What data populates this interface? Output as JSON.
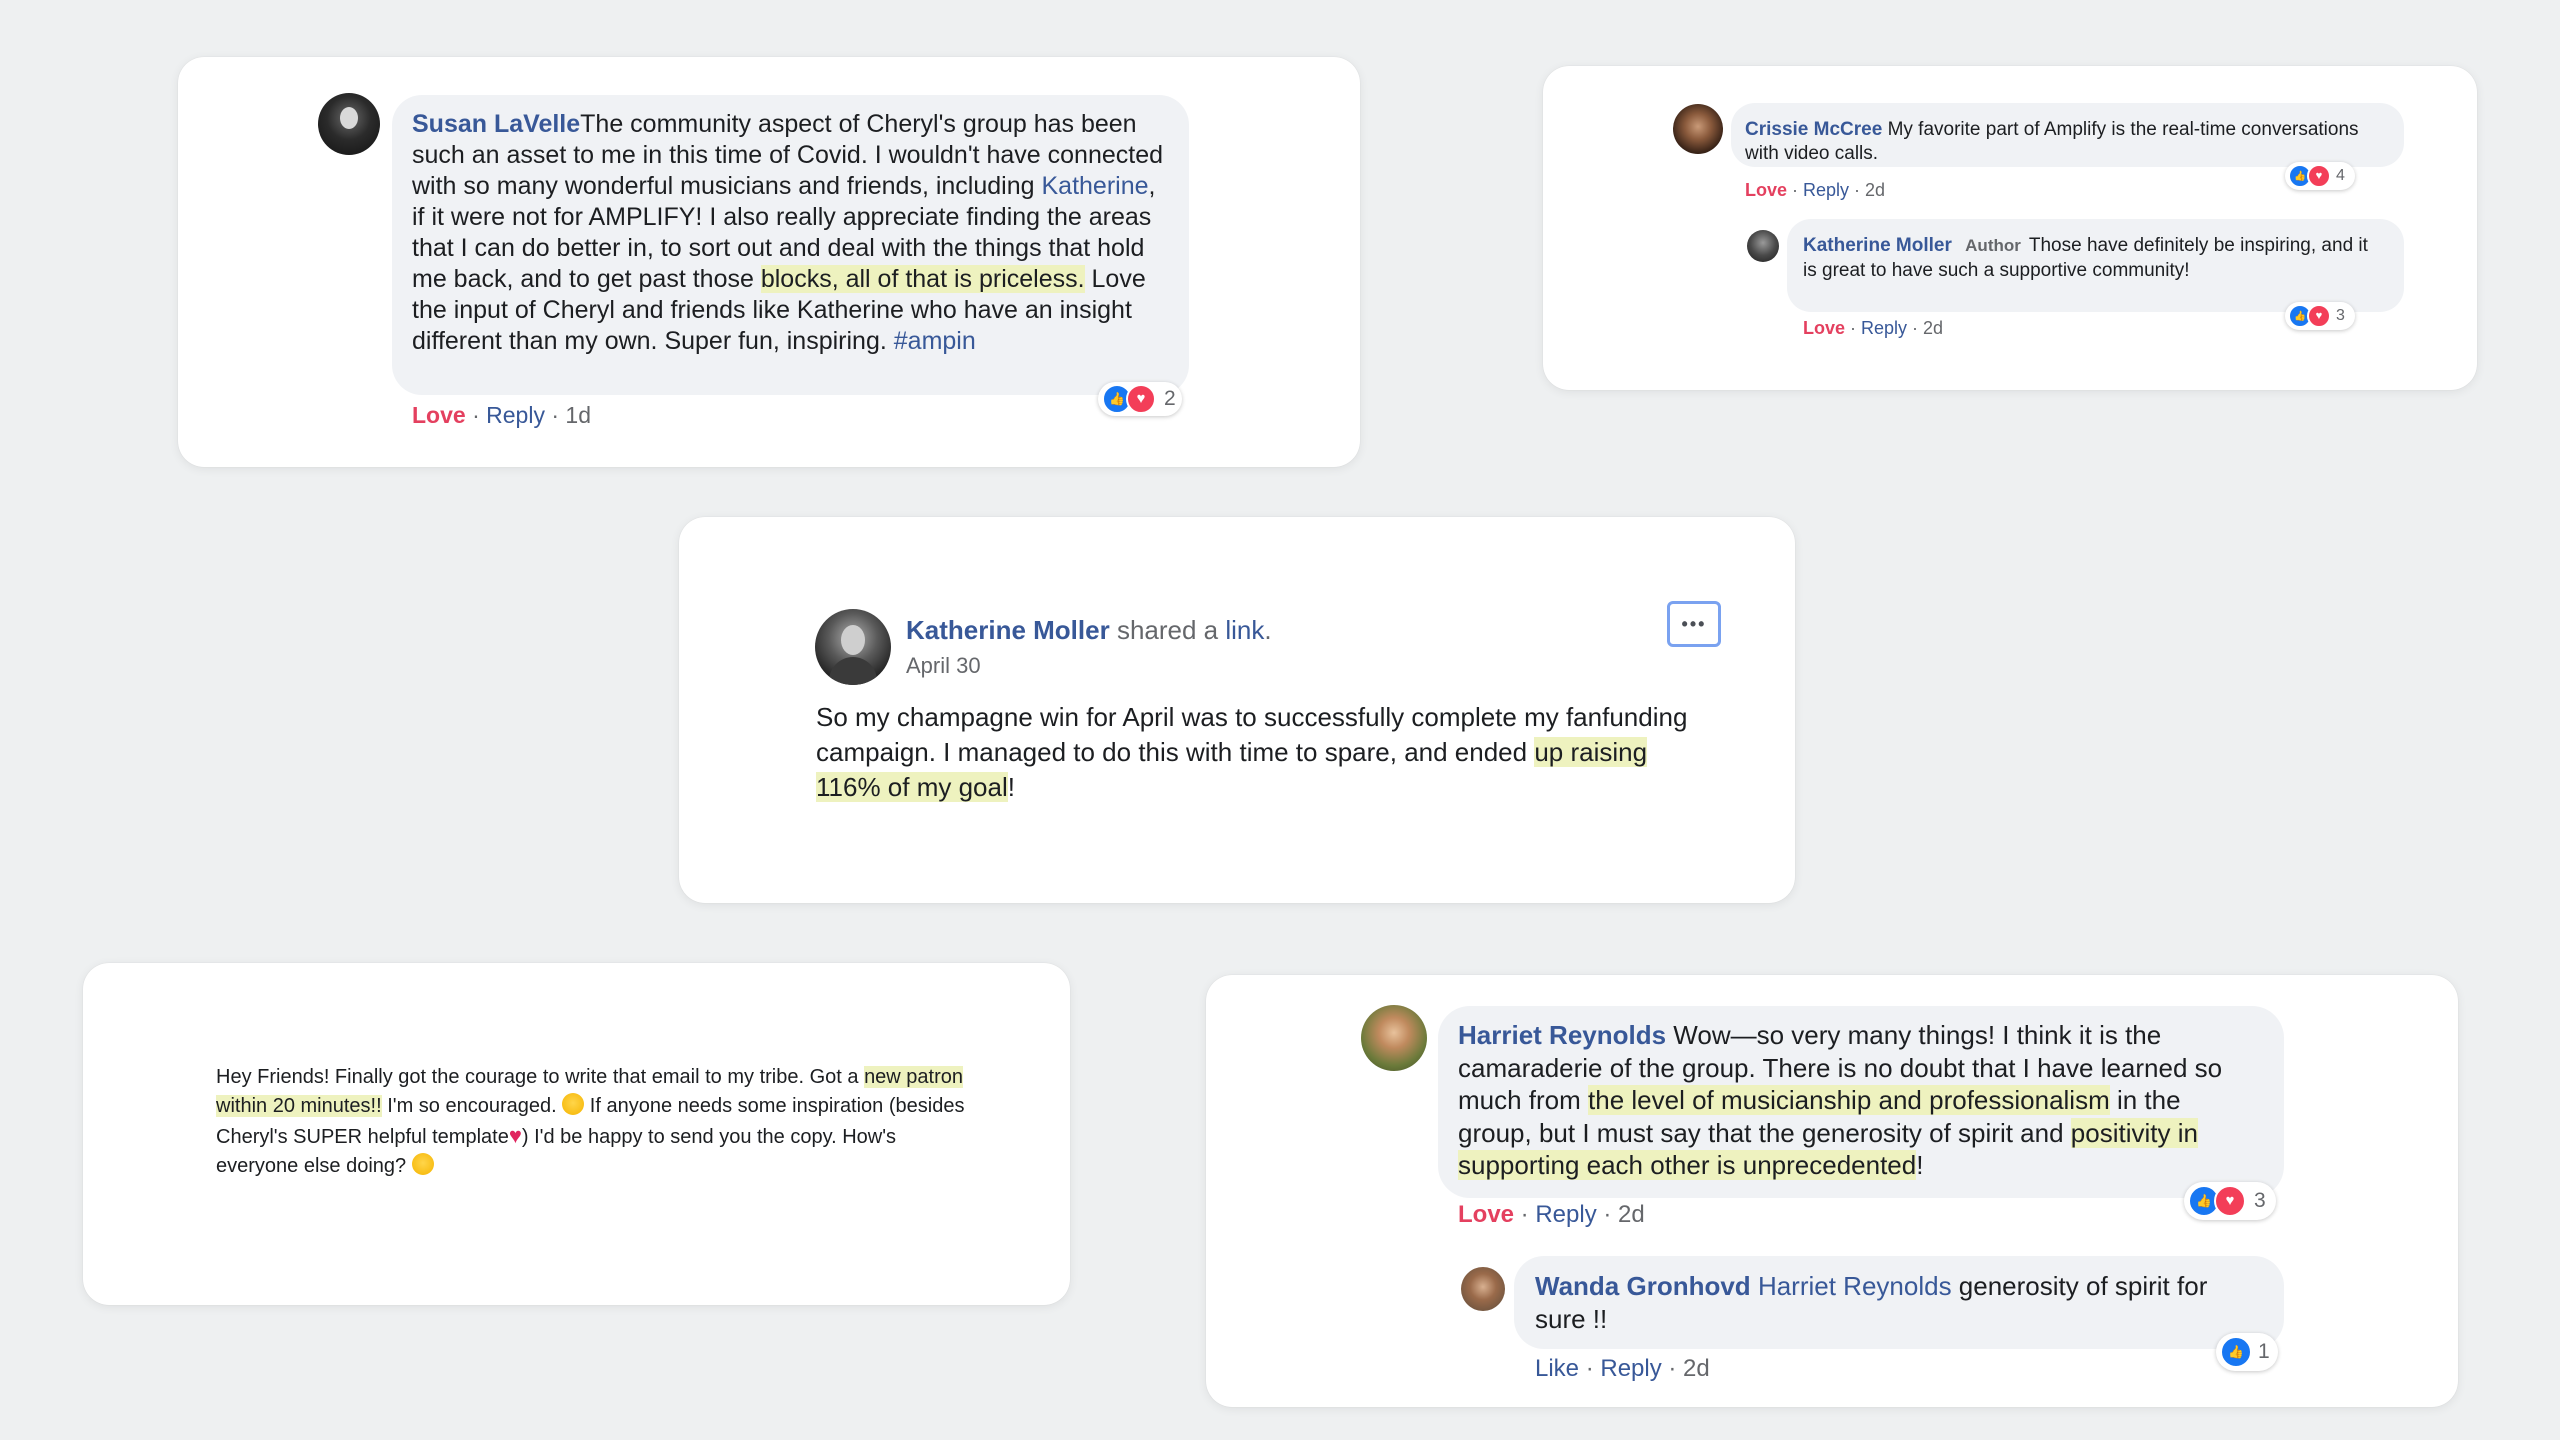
{
  "susan_card": {
    "author": "Susan LaVelle",
    "text_1": "The community aspect of Cheryl's group has been such an asset to me in this time of Covid. I wouldn't have connected with so many wonderful musicians and friends, including ",
    "mention": "Katherine",
    "text_2": ", if it were not for AMPLIFY! I also really appreciate finding the areas that I can do better in, to sort out and deal with the things that hold me back, and to get past those ",
    "highlight": "blocks, all of that is priceless.",
    "text_3": " Love the input of Cheryl and friends like Katherine who have an insight different than my own. Super fun, inspiring. ",
    "hashtag": "#ampin",
    "love_label": "Love",
    "reply_label": "Reply",
    "time": "1d",
    "reaction_count": "2"
  },
  "crissie_card": {
    "author": "Crissie McCree",
    "text": "My favorite part of Amplify is the real-time conversations with video calls.",
    "love_label": "Love",
    "reply_label": "Reply",
    "time": "2d",
    "reaction_count": "4",
    "reply": {
      "author": "Katherine Moller",
      "badge": "Author",
      "text": "Those have definitely be inspiring, and it is great to have such a supportive community!",
      "love_label": "Love",
      "reply_label": "Reply",
      "time": "2d",
      "reaction_count": "3"
    }
  },
  "post_card": {
    "author": "Katherine Moller",
    "shared_text": " shared a ",
    "link_text": "link",
    "date": "April 30",
    "more_label": "•••",
    "text_1": "So my champagne win for April was to successfully complete my fanfunding campaign. I managed to do this with time to spare, and ended ",
    "highlight": "up raising 116% of my goal",
    "text_2": "!"
  },
  "friends_card": {
    "text_1": "Hey Friends! Finally got the courage to write that email to my tribe. Got a ",
    "highlight": "new patron within 20 minutes!!",
    "text_2": " I'm so encouraged. ",
    "text_3": " If anyone needs some inspiration (besides Cheryl's SUPER helpful template",
    "text_4": ") I'd be happy to send you the copy. How's everyone else doing? "
  },
  "harriet_card": {
    "author": "Harriet Reynolds",
    "text_1": " Wow—so very many things! I think it is the camaraderie of the group. There is no doubt that I have learned so much from ",
    "highlight_1": "the level of musicianship and professionalism",
    "text_2": " in the group, but I must say that the generosity of spirit and ",
    "highlight_2": "positivity in supporting each other is unprecedented",
    "text_3": "!",
    "love_label": "Love",
    "reply_label": "Reply",
    "time": "2d",
    "reaction_count": "3",
    "reply": {
      "author": "Wanda Gronhovd",
      "mention": "Harriet Reynolds",
      "text": " generosity of spirit for sure !!",
      "like_label": "Like",
      "reply_label": "Reply",
      "time": "2d",
      "reaction_count": "1"
    }
  },
  "colors": {
    "name_blue": "#385898",
    "love_red": "#e4405f",
    "like_blue": "#1877f2",
    "highlight": "#eef2bf",
    "bubble_grey": "#f0f2f5"
  }
}
